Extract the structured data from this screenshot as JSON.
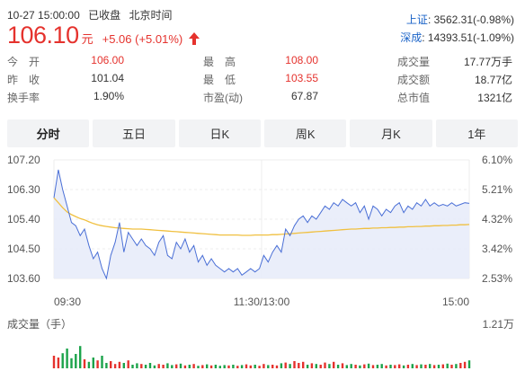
{
  "header": {
    "date_time": "10-27 15:00:00",
    "status": "已收盘",
    "timezone": "北京时间"
  },
  "quote": {
    "price": "106.10",
    "currency": "元",
    "change": "+5.06 (+5.01%)",
    "direction_icon": "up-arrow-icon",
    "up_color": "#e5322d"
  },
  "indices": [
    {
      "name": "上证",
      "value": "3562.31(-0.98%)"
    },
    {
      "name": "深成",
      "value": "14393.51(-1.09%)"
    }
  ],
  "stats": {
    "open": {
      "label": "今　开",
      "value": "106.00"
    },
    "prev_close": {
      "label": "昨　收",
      "value": "101.04"
    },
    "turnover_rate": {
      "label": "换手率",
      "value": "1.90%"
    },
    "high": {
      "label": "最　高",
      "value": "108.00"
    },
    "low": {
      "label": "最　低",
      "value": "103.55"
    },
    "pe": {
      "label": "市盈(动)",
      "value": "67.87"
    },
    "volume": {
      "label": "成交量",
      "value": "17.77万手"
    },
    "amount": {
      "label": "成交额",
      "value": "18.77亿"
    },
    "market_cap": {
      "label": "总市值",
      "value": "1321亿"
    }
  },
  "tabs": [
    {
      "label": "分时",
      "active": true
    },
    {
      "label": "五日",
      "active": false
    },
    {
      "label": "日K",
      "active": false
    },
    {
      "label": "周K",
      "active": false
    },
    {
      "label": "月K",
      "active": false
    },
    {
      "label": "1年",
      "active": false
    }
  ],
  "chart_data": {
    "type": "line",
    "y_ticks_left": [
      "107.20",
      "106.30",
      "105.40",
      "104.50",
      "103.60"
    ],
    "y_ticks_right": [
      "6.10%",
      "5.21%",
      "4.32%",
      "3.42%",
      "2.53%"
    ],
    "ylim": [
      103.6,
      107.2
    ],
    "x_labels": [
      "09:30",
      "11:30/13:00",
      "15:00"
    ],
    "volume_label": "成交量（手）",
    "volume_max_label": "1.21万",
    "price_color": "#4a6fd6",
    "avg_color": "#f0c040",
    "fill_color": "#e8ecfa",
    "price_series": [
      106.05,
      106.9,
      106.3,
      105.8,
      105.3,
      105.2,
      104.9,
      105.1,
      104.6,
      104.2,
      104.4,
      103.9,
      103.6,
      104.3,
      104.7,
      105.3,
      104.4,
      105.0,
      104.8,
      104.6,
      104.8,
      104.6,
      104.5,
      104.3,
      104.7,
      104.9,
      104.3,
      104.2,
      104.7,
      104.5,
      104.8,
      104.4,
      104.6,
      104.1,
      104.3,
      104.0,
      104.2,
      104.0,
      103.9,
      103.8,
      103.9,
      103.8,
      103.9,
      103.7,
      103.8,
      103.9,
      103.8,
      103.9,
      104.3,
      104.1,
      104.4,
      104.6,
      104.4,
      105.1,
      104.9,
      105.2,
      105.4,
      105.5,
      105.3,
      105.5,
      105.4,
      105.6,
      105.8,
      105.7,
      105.9,
      105.8,
      106.0,
      105.9,
      105.8,
      105.9,
      105.6,
      105.8,
      105.4,
      105.8,
      105.7,
      105.5,
      105.7,
      105.6,
      105.8,
      105.9,
      105.6,
      105.8,
      105.7,
      105.9,
      105.8,
      106.0,
      105.8,
      105.9,
      105.8,
      105.85,
      105.8,
      105.9,
      105.8,
      105.85,
      105.9,
      105.88
    ],
    "avg_series": [
      106.05,
      105.9,
      105.75,
      105.62,
      105.54,
      105.48,
      105.42,
      105.38,
      105.32,
      105.27,
      105.23,
      105.2,
      105.18,
      105.16,
      105.14,
      105.13,
      105.12,
      105.11,
      105.1,
      105.1,
      105.1,
      105.09,
      105.08,
      105.07,
      105.06,
      105.05,
      105.04,
      105.03,
      105.02,
      105.01,
      105.0,
      104.99,
      104.98,
      104.97,
      104.96,
      104.95,
      104.94,
      104.93,
      104.92,
      104.92,
      104.92,
      104.92,
      104.92,
      104.91,
      104.91,
      104.91,
      104.92,
      104.92,
      104.92,
      104.92,
      104.93,
      104.93,
      104.94,
      104.95,
      104.96,
      104.97,
      104.98,
      104.99,
      105.0,
      105.01,
      105.02,
      105.03,
      105.04,
      105.05,
      105.06,
      105.07,
      105.08,
      105.09,
      105.1,
      105.1,
      105.11,
      105.12,
      105.12,
      105.13,
      105.13,
      105.14,
      105.14,
      105.15,
      105.15,
      105.16,
      105.16,
      105.17,
      105.17,
      105.18,
      105.18,
      105.19,
      105.19,
      105.2,
      105.2,
      105.21,
      105.21,
      105.22,
      105.22,
      105.23,
      105.23,
      105.24
    ],
    "volume_series": [
      0.35,
      0.3,
      0.42,
      0.55,
      0.28,
      0.4,
      0.62,
      0.25,
      0.18,
      0.3,
      0.22,
      0.35,
      0.15,
      0.2,
      0.12,
      0.18,
      0.15,
      0.22,
      0.1,
      0.14,
      0.12,
      0.1,
      0.15,
      0.08,
      0.12,
      0.1,
      0.14,
      0.09,
      0.11,
      0.13,
      0.08,
      0.1,
      0.12,
      0.07,
      0.09,
      0.11,
      0.08,
      0.1,
      0.07,
      0.09,
      0.08,
      0.1,
      0.07,
      0.09,
      0.11,
      0.08,
      0.1,
      0.07,
      0.12,
      0.09,
      0.1,
      0.08,
      0.14,
      0.16,
      0.12,
      0.2,
      0.15,
      0.18,
      0.1,
      0.14,
      0.12,
      0.1,
      0.16,
      0.12,
      0.18,
      0.1,
      0.14,
      0.09,
      0.12,
      0.1,
      0.08,
      0.11,
      0.13,
      0.09,
      0.1,
      0.12,
      0.08,
      0.1,
      0.09,
      0.11,
      0.08,
      0.1,
      0.12,
      0.09,
      0.11,
      0.1,
      0.12,
      0.09,
      0.1,
      0.11,
      0.13,
      0.1,
      0.12,
      0.15,
      0.18,
      0.22
    ],
    "volume_colors": [
      "#e5322d",
      "#1ba34a",
      "#999999"
    ]
  }
}
